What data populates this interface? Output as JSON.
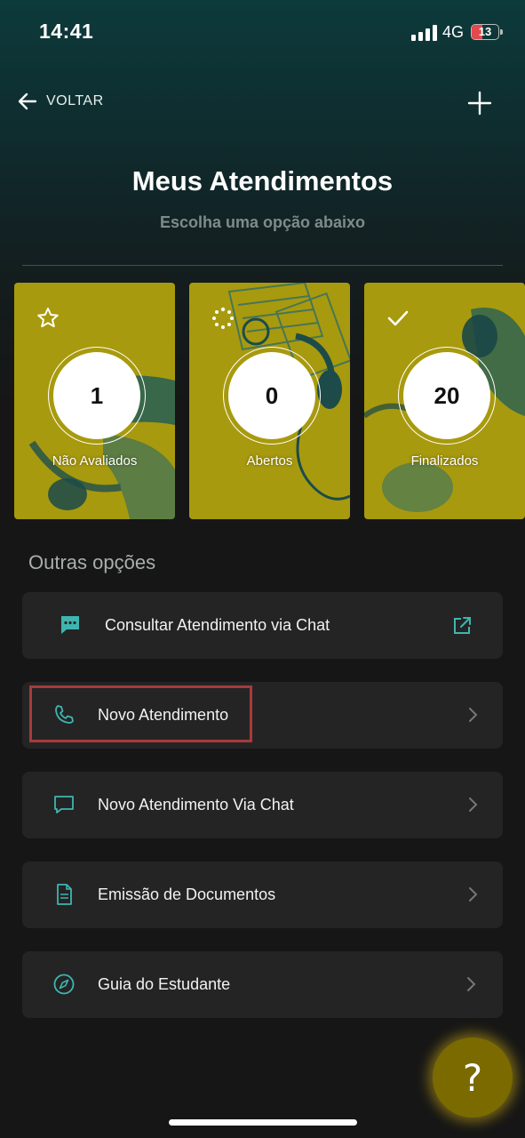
{
  "status_bar": {
    "time": "14:41",
    "network": "4G",
    "battery": "13"
  },
  "header": {
    "back_label": "VOLTAR",
    "title": "Meus Atendimentos",
    "subtitle": "Escolha uma opção abaixo"
  },
  "stats": [
    {
      "label": "Não Avaliados",
      "count": "1",
      "icon": "star-icon"
    },
    {
      "label": "Abertos",
      "count": "0",
      "icon": "dotted-circle-icon"
    },
    {
      "label": "Finalizados",
      "count": "20",
      "icon": "check-icon"
    }
  ],
  "section_title": "Outras opções",
  "options": [
    {
      "label": "Consultar Atendimento via Chat",
      "icon": "chat-bubble-icon",
      "trailing": "external-link-icon"
    },
    {
      "label": "Novo Atendimento",
      "icon": "phone-icon",
      "trailing": "chevron-right-icon"
    },
    {
      "label": "Novo Atendimento Via Chat",
      "icon": "message-icon",
      "trailing": "chevron-right-icon"
    },
    {
      "label": "Emissão de Documentos",
      "icon": "document-icon",
      "trailing": "chevron-right-icon"
    },
    {
      "label": "Guia do Estudante",
      "icon": "compass-icon",
      "trailing": "chevron-right-icon"
    }
  ],
  "help_button": "?",
  "colors": {
    "accent": "#3fb5b0",
    "card_tint": "#a89a0e",
    "highlight": "#a83a3a"
  }
}
